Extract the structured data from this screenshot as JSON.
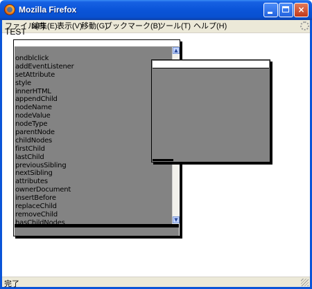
{
  "window": {
    "title": "Mozilla Firefox",
    "minimize_label": "",
    "maximize_label": "",
    "close_label": "×"
  },
  "menubar": {
    "items": [
      {
        "label": "ファイル(F)"
      },
      {
        "label": "編集(E)"
      },
      {
        "label": "表示(V)"
      },
      {
        "label": "移動(G)"
      },
      {
        "label": "ブックマーク(B)"
      },
      {
        "label": "ツール(T)"
      },
      {
        "label": "ヘルプ(H)"
      }
    ]
  },
  "page": {
    "heading": "TEST"
  },
  "listbox": {
    "items": [
      "ondblclick",
      "addEventListener",
      "setAttribute",
      "style",
      "innerHTML",
      "appendChild",
      "nodeName",
      "nodeValue",
      "nodeType",
      "parentNode",
      "childNodes",
      "firstChild",
      "lastChild",
      "previousSibling",
      "nextSibling",
      "attributes",
      "ownerDocument",
      "insertBefore",
      "replaceChild",
      "removeChild",
      "hasChildNodes"
    ],
    "scroll_up": "▲",
    "scroll_down": "▼"
  },
  "statusbar": {
    "text": "完了"
  }
}
